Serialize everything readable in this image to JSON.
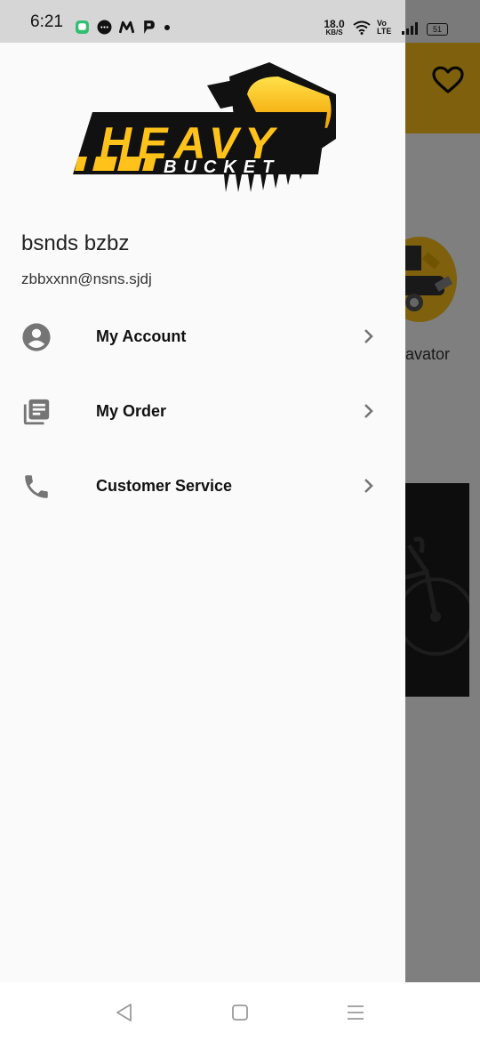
{
  "status_bar": {
    "time": "6:21",
    "net_speed_value": "18.0",
    "net_speed_unit": "KB/S",
    "volte_top": "Vo",
    "volte_bottom": "LTE",
    "battery": "51",
    "notification_icons": [
      "chat-app-icon",
      "messages-icon",
      "m-app-icon",
      "p-app-icon",
      "dot-indicator"
    ]
  },
  "background_app": {
    "category_label": "avator"
  },
  "logo": {
    "line1": "HEAVY",
    "line2": "BUCKET"
  },
  "user": {
    "name": "bsnds bzbz",
    "email": "zbbxxnn@nsns.sjdj"
  },
  "menu": {
    "items": [
      {
        "label": "My Account",
        "icon": "account-circle-icon"
      },
      {
        "label": "My Order",
        "icon": "orders-list-icon"
      },
      {
        "label": "Customer Service",
        "icon": "phone-icon"
      }
    ]
  },
  "nav_bar": {
    "buttons": [
      "back-triangle-icon",
      "home-square-icon",
      "menu-lines-icon"
    ]
  },
  "colors": {
    "brand_yellow": "#ffc21a",
    "drawer_bg": "#fafafa",
    "icon_grey": "#757575"
  }
}
